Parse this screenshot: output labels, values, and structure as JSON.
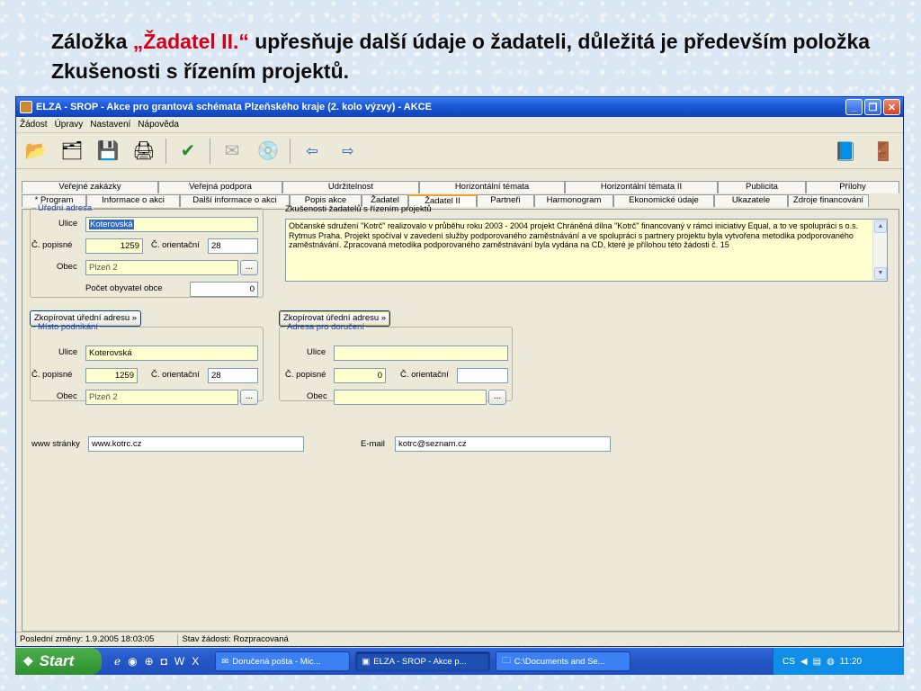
{
  "slide": {
    "title_part1": "Záložka ",
    "title_highlight": "„Žadatel II.“",
    "title_part2": " upřesňuje další údaje o žadateli, důležitá je především položka Zkušenosti s řízením projektů."
  },
  "window": {
    "title": "ELZA - SROP - Akce pro grantová schémata Plzeňského kraje (2. kolo výzvy) - AKCE",
    "buttons": {
      "minimize": "_",
      "maximize": "❐",
      "close": "✕"
    }
  },
  "menu": [
    "Žádost",
    "Úpravy",
    "Nastavení",
    "Nápověda"
  ],
  "tabs_row1": [
    "Veřejné zakázky",
    "Veřejná podpora",
    "Udržitelnost",
    "Horizontální témata",
    "Horizontální témata II",
    "Publicita",
    "Přílohy"
  ],
  "tabs_row2": [
    "* Program",
    "Informace o akci",
    "Další informace o akci",
    "Popis akce",
    "Žadatel",
    "Žadatel II",
    "Partneři",
    "Harmonogram",
    "Ekonomické údaje",
    "Ukazatele",
    "Zdroje financování"
  ],
  "official_address": {
    "legend": "Úřední adresa",
    "street_label": "Ulice",
    "street": "Koterovská",
    "popisne_label": "Č. popisné",
    "popisne": "1259",
    "orientacni_label": "Č. orientační",
    "orientacni": "28",
    "city_label": "Obec",
    "city": "Plzeň 2",
    "population_label": "Počet obyvatel obce",
    "population": "0"
  },
  "experience": {
    "label": "Zkušenosti žadatelů s řízením projektů",
    "text": "Občanské sdružení \"Kotrč\" realizovalo v průběhu roku 2003 - 2004 projekt Chráněná dílna \"Kotrč\" financovaný v rámci iniciativy Equal, a to ve spolupráci s o.s. Rytmus Praha. Projekt spočíval v zavedení služby podporovaného zaměstnávání a ve spolupráci s partnery projektu byla vytvořena metodika podporovaného zaměstnávání. Zpracovaná metodika podporovaného zaměstnávání byla vydána na CD, které je přílohou této žádosti č. 15"
  },
  "copy_button_label": "Zkopírovat úřední adresu »",
  "business_address": {
    "legend": "Místo podnikání",
    "street_label": "Ulice",
    "street": "Koterovská",
    "popisne_label": "Č. popisné",
    "popisne": "1259",
    "orientacni_label": "Č. orientační",
    "orientacni": "28",
    "city_label": "Obec",
    "city": "Plzeň 2"
  },
  "delivery_address": {
    "legend": "Adresa pro doručení",
    "street_label": "Ulice",
    "street": "",
    "popisne_label": "Č. popisné",
    "popisne": "0",
    "orientacni_label": "Č. orientační",
    "orientacni": "",
    "city_label": "Obec",
    "city": ""
  },
  "web": {
    "label": "www stránky",
    "value": "www.kotrc.cz"
  },
  "email": {
    "label": "E-mail",
    "value": "kotrc@seznam.cz"
  },
  "status": {
    "last_change": "Poslední změny: 1.9.2005 18:03:05",
    "state": "Stav žádosti: Rozpracovaná"
  },
  "taskbar": {
    "start": "Start",
    "tasks": [
      "Doručená pošta - Mic...",
      "ELZA - SROP - Akce p...",
      "C:\\Documents and Se..."
    ],
    "lang": "CS",
    "clock": "11:20"
  },
  "dots_label": "..."
}
